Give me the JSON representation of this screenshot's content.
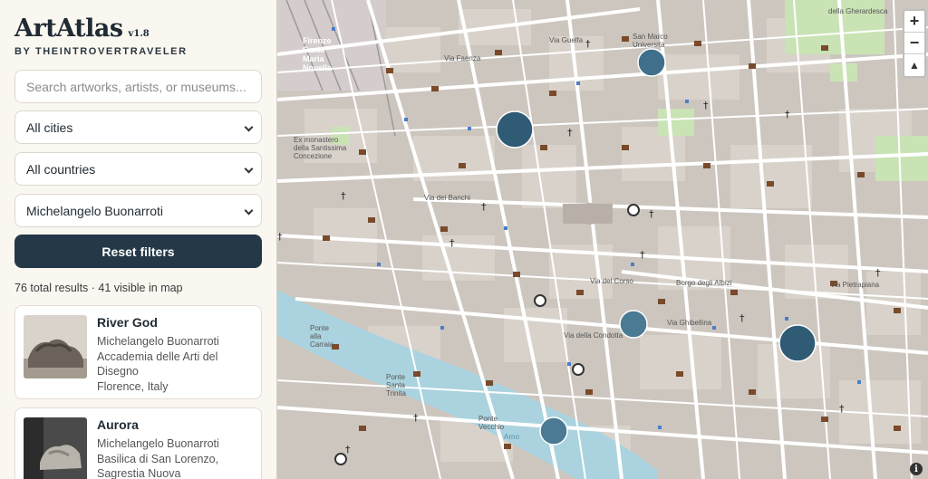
{
  "app": {
    "title": "ArtAtlas",
    "version": "v1.8",
    "subtitle": "BY THEINTROVERTRAVELER"
  },
  "filters": {
    "search_placeholder": "Search artworks, artists, or museums...",
    "city": "All cities",
    "country": "All countries",
    "artist": "Michelangelo Buonarroti",
    "reset_label": "Reset filters"
  },
  "results_text": "76 total results · 41 visible in map",
  "artworks": [
    {
      "title": "River God",
      "artist": "Michelangelo Buonarroti",
      "museum_line1": "Accademia delle Arti del",
      "museum_line2": "Disegno",
      "location": "Florence, Italy"
    },
    {
      "title": "Aurora",
      "artist": "Michelangelo Buonarroti",
      "museum_line1": "Basilica di San Lorenzo,",
      "museum_line2": "Sagrestia Nuova"
    }
  ],
  "map": {
    "zoom_in": "+",
    "zoom_out": "−",
    "reset_north": "▲",
    "info": "i",
    "labels": {
      "firenze_station": "Firenze Santa Maria Novella",
      "san_marco": "San Marco Università",
      "gherardesca": "della Gherardesca",
      "santissima": "Ex monastero della Santissima Concezione",
      "ponte_carraia": "Ponte alla Carraia",
      "ponte_trinita": "Ponte Santa Trinita",
      "ponte_vecchio": "Ponte Vecchio",
      "arno": "Arno",
      "via_pietrapiana": "Via Pietrapiana",
      "borgo_albizi": "Borgo degli Albizi",
      "via_ghibellina": "Via Ghibellina",
      "via_condotta": "Via della Condotta",
      "via_corso": "Via del Corso",
      "via_banchi": "Via dei Banchi",
      "via_faenza": "Via Faenza",
      "via_guelfa": "Via Guelfa"
    }
  },
  "colors": {
    "accent": "#243847",
    "cluster": "#2f5b75",
    "cluster_light": "#5a8aa6",
    "road": "#ffffff",
    "river": "#a8d2e0"
  }
}
